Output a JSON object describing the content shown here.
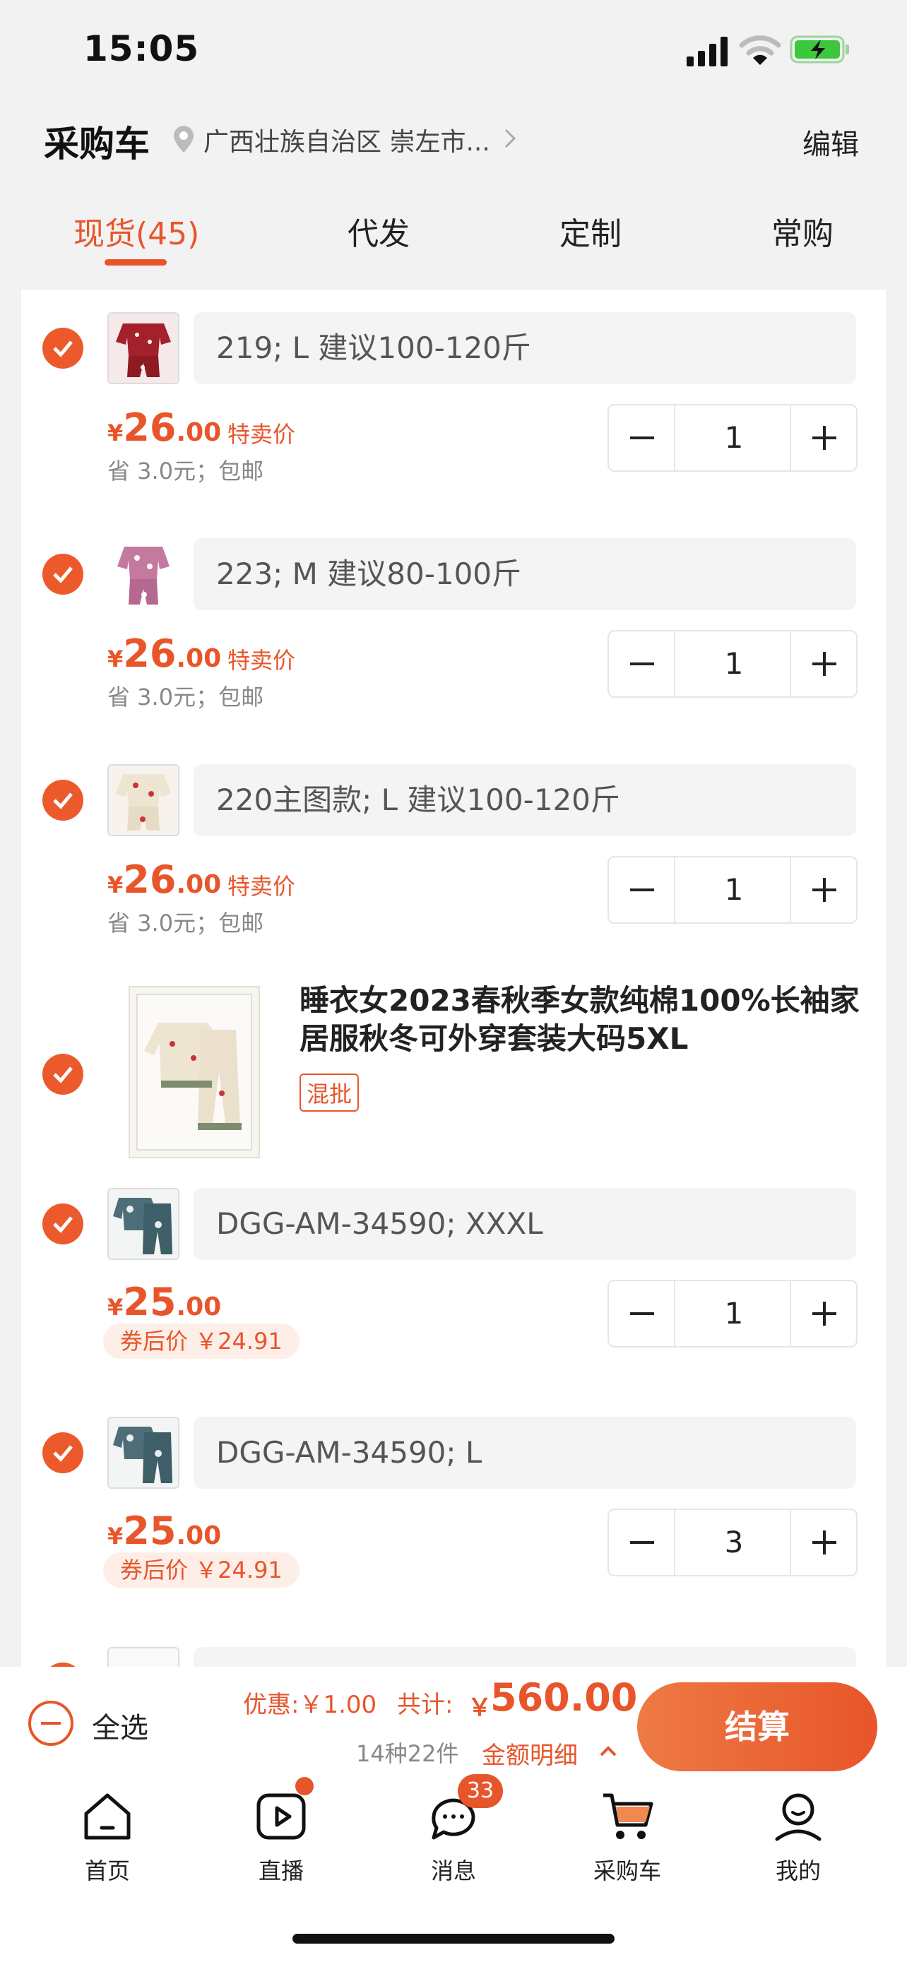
{
  "status": {
    "time": "15:05"
  },
  "header": {
    "title": "采购车",
    "location": "广西壮族自治区 崇左市...",
    "edit": "编辑"
  },
  "tabs": [
    {
      "label": "现货(45)"
    },
    {
      "label": "代发"
    },
    {
      "label": "定制"
    },
    {
      "label": "常购"
    }
  ],
  "items": [
    {
      "sku": "219; L 建议100-120斤",
      "yen": "¥",
      "price_int": "26",
      "price_dec": ".00",
      "tag": "特卖价",
      "save": "省 3.0元；包邮",
      "qty": "1"
    },
    {
      "sku": "223; M 建议80-100斤",
      "yen": "¥",
      "price_int": "26",
      "price_dec": ".00",
      "tag": "特卖价",
      "save": "省 3.0元；包邮",
      "qty": "1"
    },
    {
      "sku": "220主图款; L 建议100-120斤",
      "yen": "¥",
      "price_int": "26",
      "price_dec": ".00",
      "tag": "特卖价",
      "save": "省 3.0元；包邮",
      "qty": "1"
    }
  ],
  "product": {
    "title": "睡衣女2023春秋季女款纯棉100%长袖家居服秋冬可外穿套装大码5XL",
    "badge": "混批"
  },
  "items2": [
    {
      "sku": "DGG-AM-34590; XXXL",
      "yen": "¥",
      "price_int": "25",
      "price_dec": ".00",
      "coupon": "券后价 ￥24.91",
      "qty": "1"
    },
    {
      "sku": "DGG-AM-34590; L",
      "yen": "¥",
      "price_int": "25",
      "price_dec": ".00",
      "coupon": "券后价 ￥24.91",
      "qty": "3"
    }
  ],
  "footer": {
    "select_all": "全选",
    "discount": "优惠:￥1.00",
    "total_label": "共计:",
    "total_yen": "￥",
    "total_value": "560.00",
    "count": "14种22件",
    "detail": "金额明细",
    "checkout": "结算"
  },
  "nav": [
    {
      "label": "首页",
      "icon": "home-icon"
    },
    {
      "label": "直播",
      "icon": "live-play-icon"
    },
    {
      "label": "消息",
      "icon": "message-icon",
      "badge": "33"
    },
    {
      "label": "采购车",
      "icon": "cart-icon"
    },
    {
      "label": "我的",
      "icon": "profile-icon"
    }
  ],
  "colors": {
    "accent": "#e8552a",
    "background": "#f2f2f2"
  }
}
